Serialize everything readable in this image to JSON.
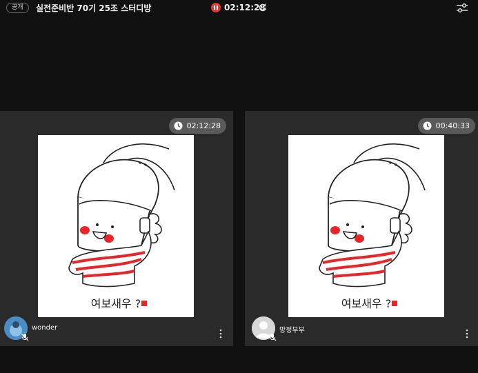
{
  "header": {
    "visibility_badge": "공개",
    "room_title": "실전준비반 70기 25조 스터디방",
    "timer": "02:12:28",
    "colors": {
      "record": "#e53935",
      "background": "#111111",
      "card": "#2a2a2a"
    }
  },
  "participants": [
    {
      "name": "wonder",
      "timer": "02:12:28",
      "video_caption": "여보새우 ?",
      "avatar": "profile-photo",
      "mic_status": "muted"
    },
    {
      "name": "방정부부",
      "timer": "00:40:33",
      "video_caption": "여보새우 ?",
      "avatar": "default-person-icon",
      "mic_status": "muted"
    }
  ]
}
